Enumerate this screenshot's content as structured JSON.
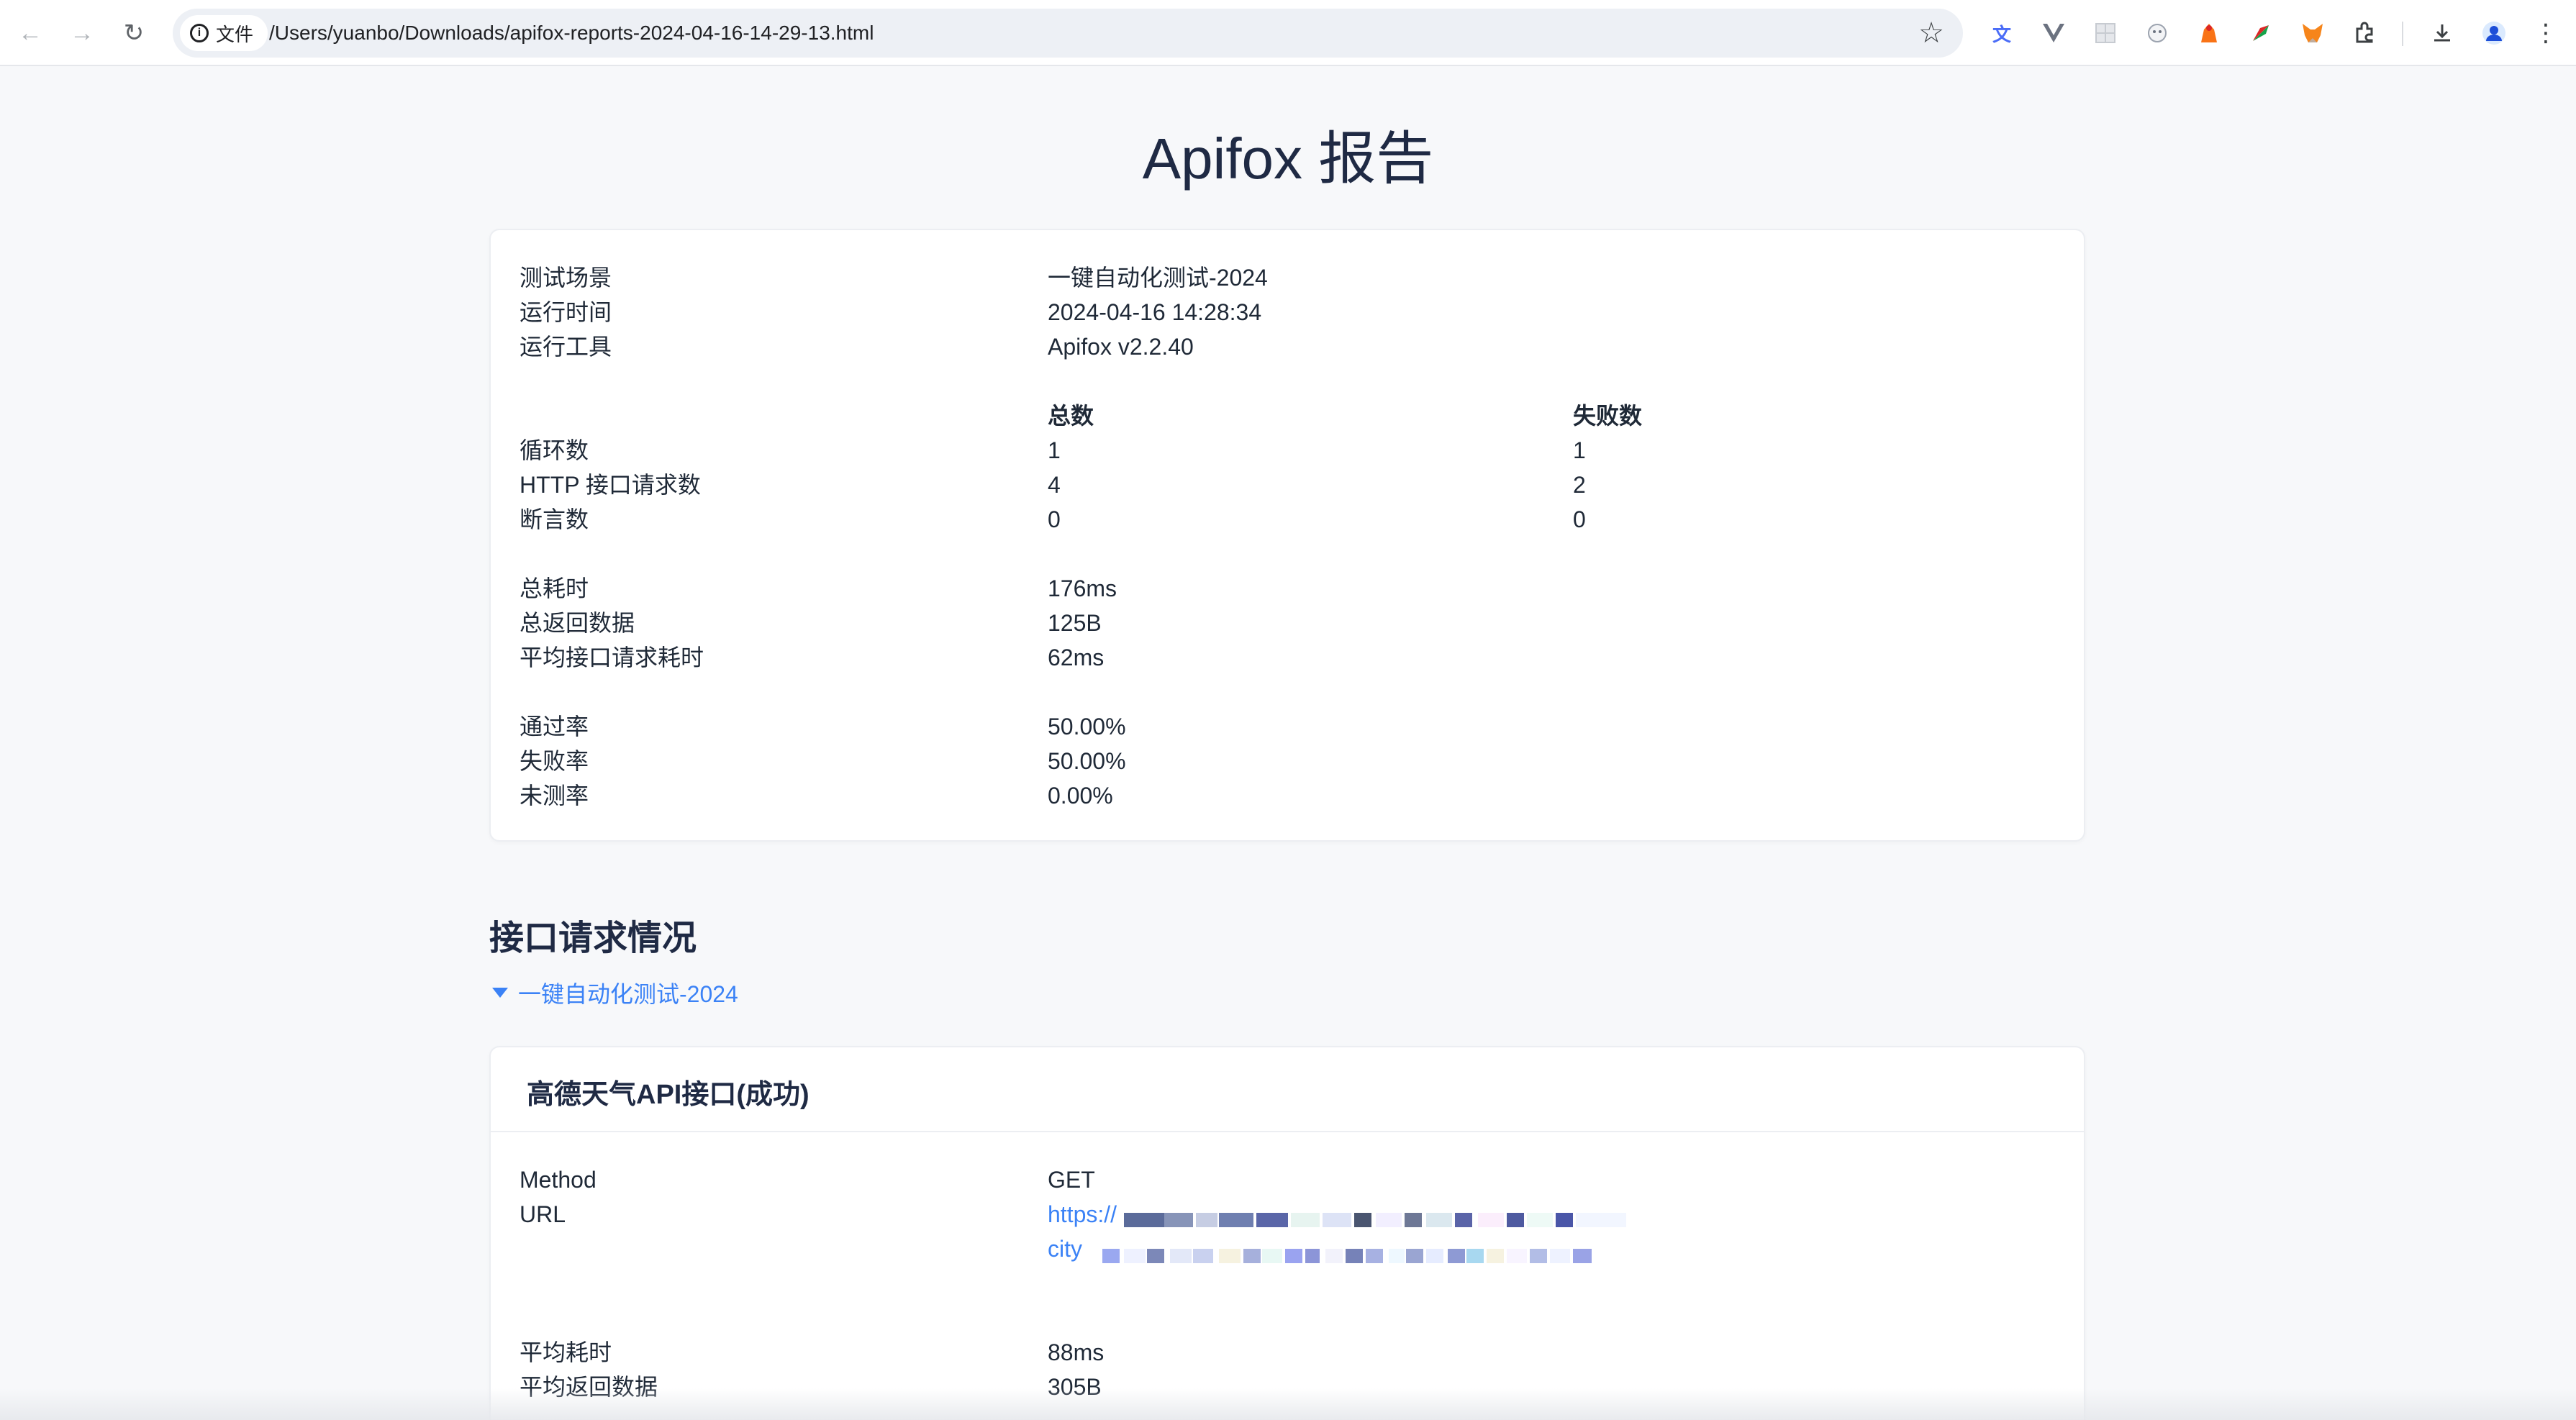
{
  "browser": {
    "back_icon": "arrow-left-icon",
    "forward_icon": "arrow-right-icon",
    "reload_icon": "reload-icon",
    "chip_label": "文件",
    "url": "/Users/yuanbo/Downloads/apifox-reports-2024-04-16-14-29-13.html",
    "bookmark_icon": "star-icon",
    "extensions": [
      "translate-icon",
      "vue-devtools-icon",
      "grid-extension-icon",
      "panda-extension-icon",
      "puzzle-piece-icon",
      "metamask-fox-icon",
      "extensions-puzzle-icon"
    ],
    "download_icon": "download-icon",
    "profile_icon": "profile-avatar-icon",
    "menu_icon": "kebab-menu-icon"
  },
  "report": {
    "title": "Apifox 报告",
    "info": [
      {
        "label": "测试场景",
        "value": "一键自动化测试-2024"
      },
      {
        "label": "运行时间",
        "value": "2024-04-16 14:28:34"
      },
      {
        "label": "运行工具",
        "value": "Apifox v2.2.40"
      }
    ],
    "stats_header": {
      "total": "总数",
      "failed": "失败数"
    },
    "stats": [
      {
        "label": "循环数",
        "total": "1",
        "failed": "1"
      },
      {
        "label": "HTTP 接口请求数",
        "total": "4",
        "failed": "2"
      },
      {
        "label": "断言数",
        "total": "0",
        "failed": "0"
      }
    ],
    "timing": [
      {
        "label": "总耗时",
        "value": "176ms"
      },
      {
        "label": "总返回数据",
        "value": "125B"
      },
      {
        "label": "平均接口请求耗时",
        "value": "62ms"
      }
    ],
    "rates": [
      {
        "label": "通过率",
        "value": "50.00%"
      },
      {
        "label": "失败率",
        "value": "50.00%"
      },
      {
        "label": "未测率",
        "value": "0.00%"
      }
    ]
  },
  "requests": {
    "section_title": "接口请求情况",
    "folder_label": "一键自动化测试-2024",
    "item": {
      "title": "高德天气API接口(成功)",
      "method_label": "Method",
      "method_value": "GET",
      "url_label": "URL",
      "url_line1": "https://",
      "url_line2": "city",
      "avg_time_label": "平均耗时",
      "avg_time_value": "88ms",
      "avg_data_label": "平均返回数据",
      "avg_data_value": "305B"
    }
  }
}
